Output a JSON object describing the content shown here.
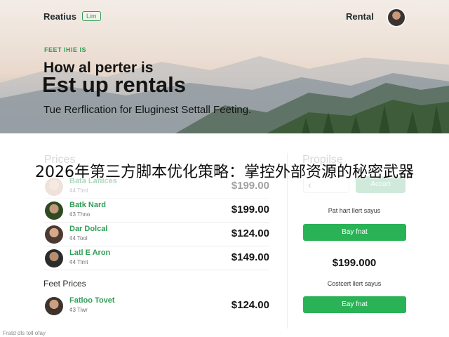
{
  "header": {
    "logo": "Reatius",
    "logo_tag": "Lim",
    "nav_label": "Rental"
  },
  "hero": {
    "eyebrow": "FEET IHIE IS",
    "headline_1": "How al perter is",
    "headline_2": "Est up rentals",
    "subheadline": "Tue Rerflication for Eluginest Settall Feeting."
  },
  "prices": {
    "title": "Prices",
    "items": [
      {
        "name": "Bata Lafilces",
        "sub": "¢4 Tlmt",
        "price": "$199.00",
        "avatar_color": "#d7b9a4"
      },
      {
        "name": "Batk Nard",
        "sub": "¢3 Thno",
        "price": "$199.00",
        "avatar_color": "#4a6a3a"
      },
      {
        "name": "Dar Dolcal",
        "sub": "¢4 Tool",
        "price": "$124.00",
        "avatar_color": "#5a4a40"
      },
      {
        "name": "Latl E Aron",
        "sub": "¢4 Tlmt",
        "price": "$149.00",
        "avatar_color": "#3a3a3a"
      }
    ],
    "feet_title": "Feet Prices",
    "feet_items": [
      {
        "name": "Fatloo Tovet",
        "sub": "¢3 Tiwr",
        "price": "$124.00",
        "avatar_color": "#5a463c"
      }
    ]
  },
  "side": {
    "title": "Propilse",
    "back_label": "‹",
    "accent_label": "Accort",
    "label_1": "Pat hart llert sayus",
    "button_1": "Bay fnat",
    "price": "$199.000",
    "label_2": "Costcert llert sayus",
    "button_2": "Eay fnat"
  },
  "footer_note": "Fratd dls toll ofay",
  "overlay_caption": "2026年第三方脚本优化策略：掌控外部资源的秘密武器",
  "colors": {
    "accent_green": "#2ab256",
    "accent_green_light": "#cfeadb",
    "text_dark": "#141414"
  }
}
